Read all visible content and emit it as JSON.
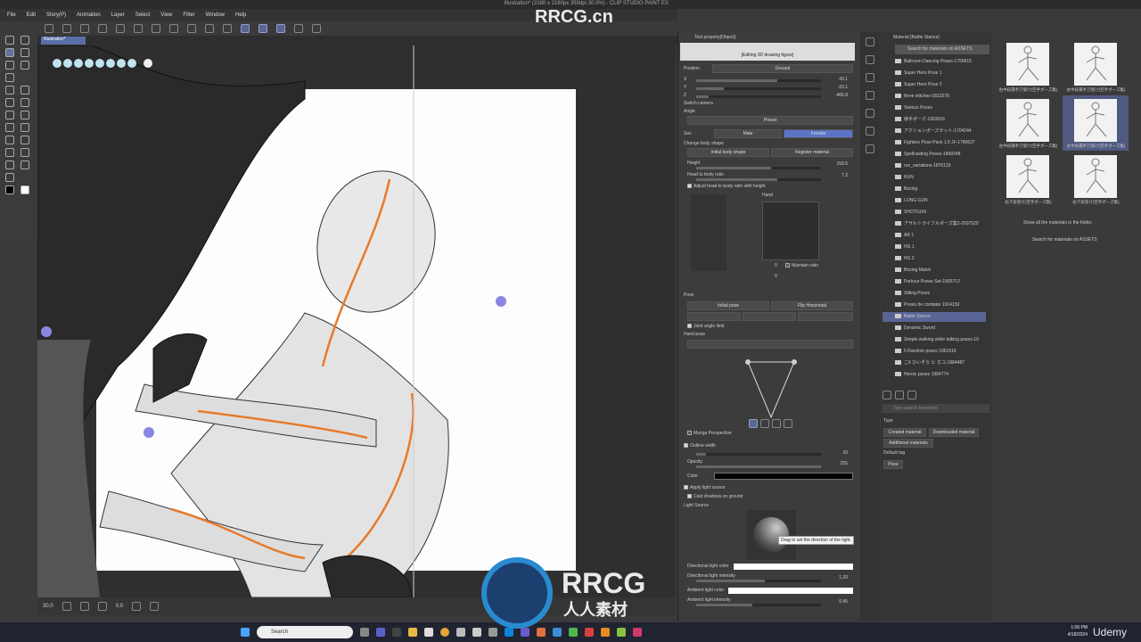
{
  "window": {
    "title": "Illustration* (2160 x 2160px 350dpi 30.0%) - CLIP STUDIO PAINT EX"
  },
  "menu": [
    "File",
    "Edit",
    "Story(P)",
    "Animation",
    "Layer",
    "Select",
    "View",
    "Filter",
    "Window",
    "Help"
  ],
  "canvas": {
    "tab": "Illustration*",
    "zoom": "30.0",
    "angle": "0.0"
  },
  "tool_property": {
    "header": "Tool property[Object]",
    "subheader": "[Editing 3D drawing figure]",
    "position_label": "Position",
    "ground_btn": "Ground",
    "x_label": "X",
    "x": "43.1",
    "y_label": "Y",
    "y": "-23.1",
    "z_label": "Z",
    "z": "-465.8",
    "switch_camera": "Switch camera",
    "angle_label": "Angle",
    "preset": "Preset",
    "sex_label": "Sex",
    "male": "Male",
    "female": "Female",
    "change_body": "Change body shape",
    "initial_body": "Initial body shape",
    "register": "Register material",
    "height_label": "Height",
    "height": "159.5",
    "head_ratio_label": "Head to body ratio",
    "head_ratio": "7.2",
    "adjust_head": "Adjust head to body ratio with height",
    "hand_label": "Hand",
    "maintain_ratio": "Maintain ratio",
    "hand_v1": "0",
    "hand_v2": "0",
    "pose": "Pose",
    "initial_pose": "Initial pose",
    "flip": "Flip Horizontal",
    "joint_angle": "Joint angle limit",
    "hand_pose": "Hand pose",
    "manga_perspective": "Manga Perspective",
    "outline_width": "Outline width",
    "outline_val": "10",
    "opacity_label": "Opacity",
    "opacity": "255",
    "color_label": "Color",
    "apply_light": "Apply light source",
    "cast_shadows": "Cast shadows on ground",
    "light_source": "Light Source",
    "tooltip": "Drag to set the direction of the light.",
    "dir_color": "Directional light color",
    "dir_intensity_label": "Directional light intensity",
    "dir_intensity": "1.20",
    "amb_color": "Ambient light color",
    "amb_intensity_label": "Ambient light intensity",
    "amb_intensity": "0.45"
  },
  "material": {
    "header": "Material [Battle Stance]",
    "search_assets": "Search for materials on ASSETS",
    "items": [
      "Ballroom Dancing Poses-1756815",
      "Super Hero Pose 1",
      "Super Hero Pose 2",
      "three stitches-1813278",
      "Various Poses",
      "様手ポーズ-1663616",
      "アクションポーズセット-1704244",
      "Fighters Pose Pack 1.0 JF-1780637",
      "Spellcasting Poses-1849348",
      "run_variations-1876133",
      "RUN",
      "Boxing",
      "LONG GUN",
      "SHOTGUN",
      "アサルトライフルポーズ集2-2007520",
      "AR 1",
      "HG 1",
      "HG 2",
      "Boxing Match",
      "Parkour Poses Set-1905713",
      "Sitting Poses",
      "Poses de combate 1914159",
      "Battle Stance",
      "Dynamic Sword",
      "Simple walking while talking poses-19",
      "5 Random poses 1961616",
      "こ6 ひいそら ヒ ホコ-1984487",
      "Heroic poses 1964774"
    ],
    "selected": 22,
    "search_placeholder": "Type search keywords",
    "type_label": "Type",
    "created": "Created material",
    "downloaded": "Downloaded material",
    "additional": "Additional materials",
    "default_tag_label": "Default tag",
    "pose_tag": "Pose"
  },
  "thumbnails": {
    "captions": [
      "右中段揚手刀受け(空手ポーズ集)",
      "右中段揚手刀受け(空手ポーズ集)",
      "左中段揚手刀受け(空手ポーズ集)",
      "左中段揚手刀受け(空手ポーズ集)",
      "右下段受け(空手ポーズ集)",
      "右下段受け(空手ポーズ集)"
    ],
    "selected": 3,
    "show_all": "Show all the materials in the folder.",
    "search_assets": "Search for materials on ASSETS"
  },
  "taskbar": {
    "search": "Search",
    "time": "1:06 PM",
    "date": "4/18/2024"
  },
  "watermarks": {
    "rrcg": "RRCG.cn",
    "logo": "RRCG",
    "logo_sub": "人人素材",
    "udemy": "Udemy"
  }
}
